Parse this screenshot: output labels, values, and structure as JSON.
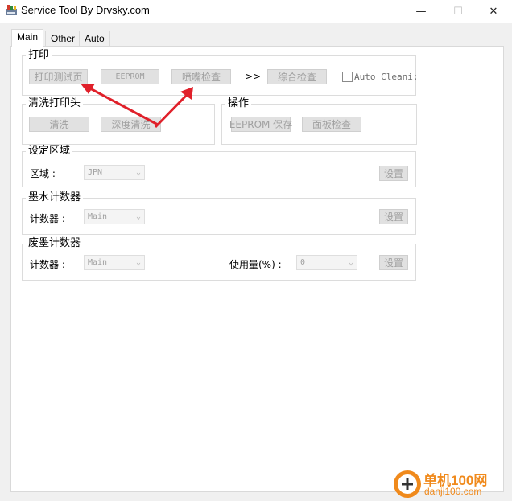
{
  "window": {
    "title": "Service Tool By Drvsky.com",
    "app_icon": "printer-app-icon",
    "minimize_glyph": "—",
    "maximize_glyph": "☐",
    "close_glyph": "✕"
  },
  "tabs": [
    {
      "label": "Main",
      "active": true
    },
    {
      "label": "Other",
      "active": false
    },
    {
      "label": "Auto",
      "active": false
    }
  ],
  "print_group": {
    "title": "打印",
    "test_page_label": "打印测试页",
    "eeprom_label": "EEPROM",
    "nozzle_check_label": "喷嘴检查",
    "arrow_text": ">>",
    "comprehensive_check_label": "综合检查",
    "auto_clean_label": "Auto Cleani:"
  },
  "clean_group": {
    "title": "清洗打印头",
    "clean_label": "清洗",
    "deep_clean_label": "深度清洗"
  },
  "ops_group": {
    "title": "操作",
    "eeprom_save_label": "EEPROM 保存",
    "panel_check_label": "面板检查"
  },
  "region_group": {
    "title": "设定区域",
    "field_label": "区域 :",
    "selected": "JPN",
    "set_label": "设置"
  },
  "ink_counter_group": {
    "title": "墨水计数器",
    "field_label": "计数器 :",
    "selected": "Main",
    "set_label": "设置"
  },
  "waste_counter_group": {
    "title": "废墨计数器",
    "field_label": "计数器 :",
    "selected": "Main",
    "usage_label": "使用量(%) :",
    "usage_value": "0",
    "set_label": "设置"
  },
  "watermark": {
    "text_cn": "单机100网",
    "text_url": "danji100.com"
  },
  "colors": {
    "annotation_arrow": "#e0202a",
    "watermark_orange": "#f08a1c"
  }
}
